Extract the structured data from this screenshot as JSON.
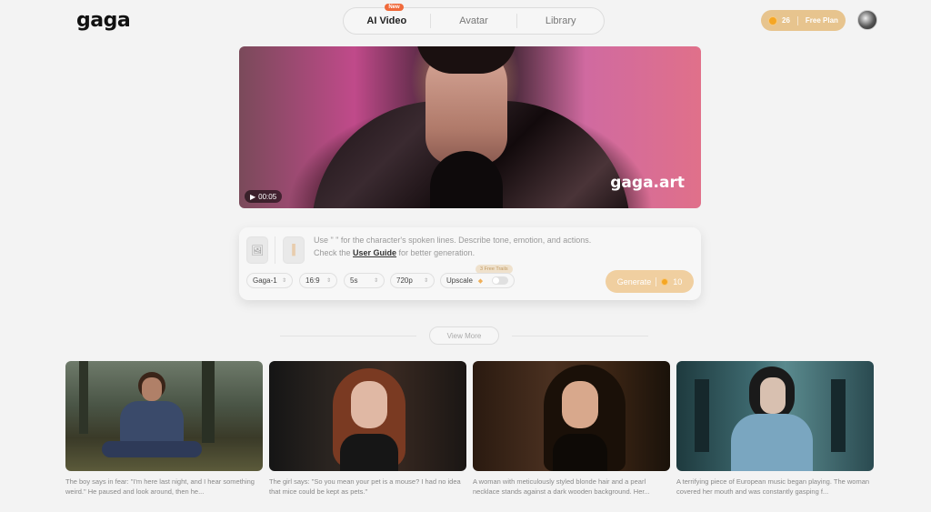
{
  "brand": {
    "logo": "gaga"
  },
  "nav": {
    "tabs": [
      {
        "label": "AI Video",
        "badge": "New",
        "active": true
      },
      {
        "label": "Avatar",
        "active": false
      },
      {
        "label": "Library",
        "active": false
      }
    ]
  },
  "account": {
    "credits": "26",
    "plan": "Free Plan"
  },
  "hero": {
    "watermark": "gaga.art",
    "duration": "00:05"
  },
  "prompt": {
    "line1": "Use \" \" for the character's spoken lines. Describe tone, emotion, and actions.",
    "line2_prefix": "Check the ",
    "line2_link": "User Guide",
    "line2_suffix": " for better generation."
  },
  "options": {
    "model": "Gaga-1",
    "ratio": "16:9",
    "duration": "5s",
    "resolution": "720p",
    "upscale_label": "Upscale",
    "trial_badge": "3 Free Trails"
  },
  "generate": {
    "label": "Generate",
    "cost": "10"
  },
  "view_more": "View More",
  "cards": [
    {
      "caption": "The boy says in fear: \"I'm here last night, and I hear something weird.\" He paused and look around, then he..."
    },
    {
      "caption": "The girl says: \"So you mean your pet is a mouse? I had no idea that mice could be kept as pets.\""
    },
    {
      "caption": "A woman with meticulously styled blonde hair and a pearl necklace stands against a dark wooden background. Her..."
    },
    {
      "caption": "A terrifying piece of European music began playing. The woman covered her mouth and was constantly gasping f..."
    }
  ],
  "colors": {
    "accent": "#e7c48e",
    "badge": "#f06a3b",
    "generate": "#f0cfa0"
  }
}
